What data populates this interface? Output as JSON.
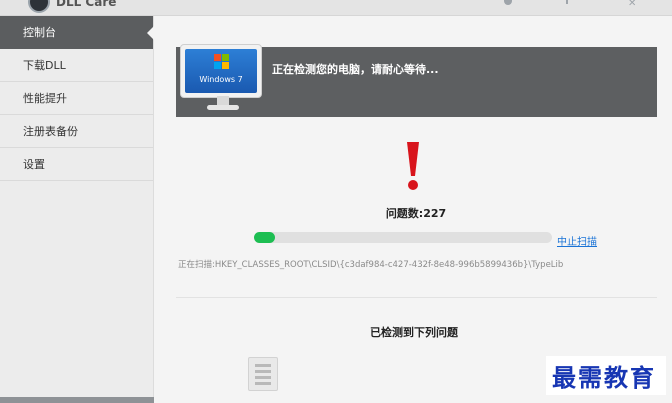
{
  "app": {
    "title": "DLL Care"
  },
  "sidebar": {
    "items": [
      {
        "label": "控制台",
        "active": true
      },
      {
        "label": "下载DLL",
        "active": false
      },
      {
        "label": "性能提升",
        "active": false
      },
      {
        "label": "注册表备份",
        "active": false
      },
      {
        "label": "设置",
        "active": false
      }
    ]
  },
  "banner": {
    "os_label": "Windows 7",
    "message": "正在检测您的电脑，请耐心等待..."
  },
  "status": {
    "icon": "exclamation-icon",
    "count_text": "问题数:227",
    "progress_percent": 7,
    "stop_label": "中止扫描",
    "scan_path": "正在扫描:HKEY_CLASSES_ROOT\\CLSID\\{c3daf984-c427-432f-8e48-996b5899436b}\\TypeLib"
  },
  "problems": {
    "title": "已检测到下列问题"
  },
  "watermark": {
    "text": "最需教育"
  },
  "colors": {
    "accent_green": "#1dbe52",
    "link_blue": "#1a73d6",
    "warning_red": "#d8141c",
    "sidebar_active": "#5b5d5f"
  }
}
